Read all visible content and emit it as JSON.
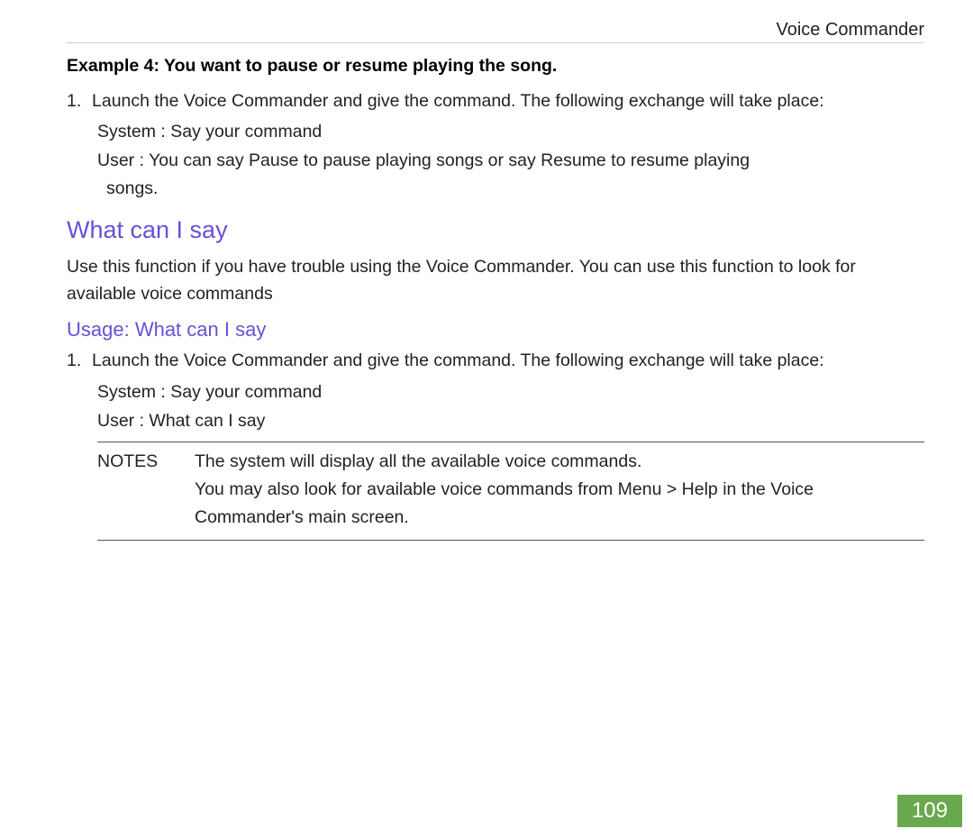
{
  "header": {
    "title": "Voice Commander"
  },
  "example4": {
    "title": "Example 4: You want to pause or resume playing the song.",
    "step1_marker": "1.",
    "step1_text": "Launch the Voice Commander and give the command. The following exchange will take place:",
    "system_line": "System :  Say your command",
    "user_line1": "User : You can say  Pause  to pause playing songs or say  Resume  to resume playing",
    "user_line2": "songs."
  },
  "section1": {
    "heading": "What can I say",
    "para": "Use this function if you have trouble using the Voice Commander. You can use this function to look for available voice commands"
  },
  "section2": {
    "heading": "Usage: What can I say",
    "step1_marker": "1.",
    "step1_text": "Launch the Voice Commander and give the command. The following exchange will take place:",
    "system_line": "System :  Say your command",
    "user_line": "User :  What can I say"
  },
  "notes": {
    "label": "NOTES",
    "line1": "The system will display all the available voice commands.",
    "line2": "You may also look for available voice commands from Menu > Help  in the Voice Commander's main screen."
  },
  "page_number": "109"
}
